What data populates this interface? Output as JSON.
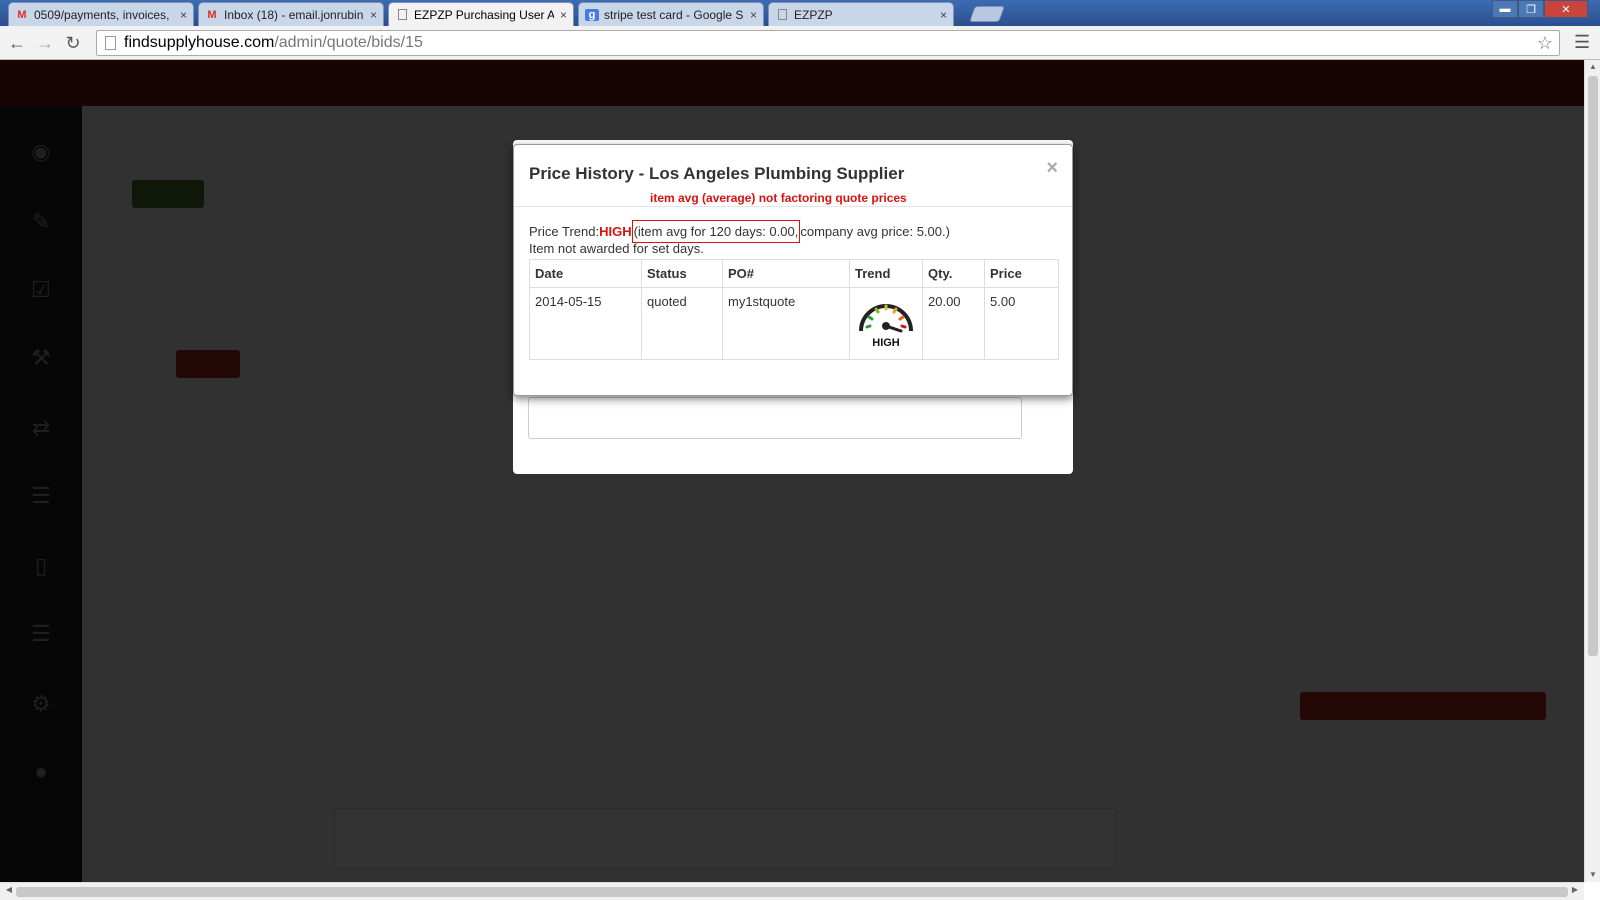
{
  "browser": {
    "tabs": [
      {
        "label": "0509/payments, invoices,",
        "icon": "gmail-icon"
      },
      {
        "label": "Inbox (18) - email.jonrubin",
        "icon": "gmail-icon"
      },
      {
        "label": "EZPZP Purchasing User Ac",
        "icon": "page-icon",
        "active": true
      },
      {
        "label": "stripe test card - Google S",
        "icon": "google-icon"
      },
      {
        "label": "EZPZP",
        "icon": "page-icon"
      }
    ],
    "close_glyph": "×",
    "url_host": "findsupplyhouse.com",
    "url_path": "/admin/quote/bids/15"
  },
  "modal": {
    "title": "Price History - Los Angeles Plumbing Supplier",
    "close_glyph": "×",
    "note": "item avg (average) not factoring quote prices",
    "trend_prefix": "Price Trend: ",
    "trend_value": "HIGH",
    "item_avg_text": "(item avg for 120 days: 0.00,",
    "company_avg_text": " company avg price: 5.00.)",
    "not_awarded": "Item not awarded for set days.",
    "table": {
      "headers": [
        "Date",
        "Status",
        "PO#",
        "Trend",
        "Qty.",
        "Price"
      ],
      "rows": [
        {
          "date": "2014-05-15",
          "status": "quoted",
          "po": "my1stquote",
          "trend_label": "HIGH",
          "qty": "20.00",
          "price": "5.00"
        }
      ]
    }
  },
  "colors": {
    "alert_red": "#d9120d",
    "app_header": "#7a1a12",
    "sidebar": "#222222"
  }
}
